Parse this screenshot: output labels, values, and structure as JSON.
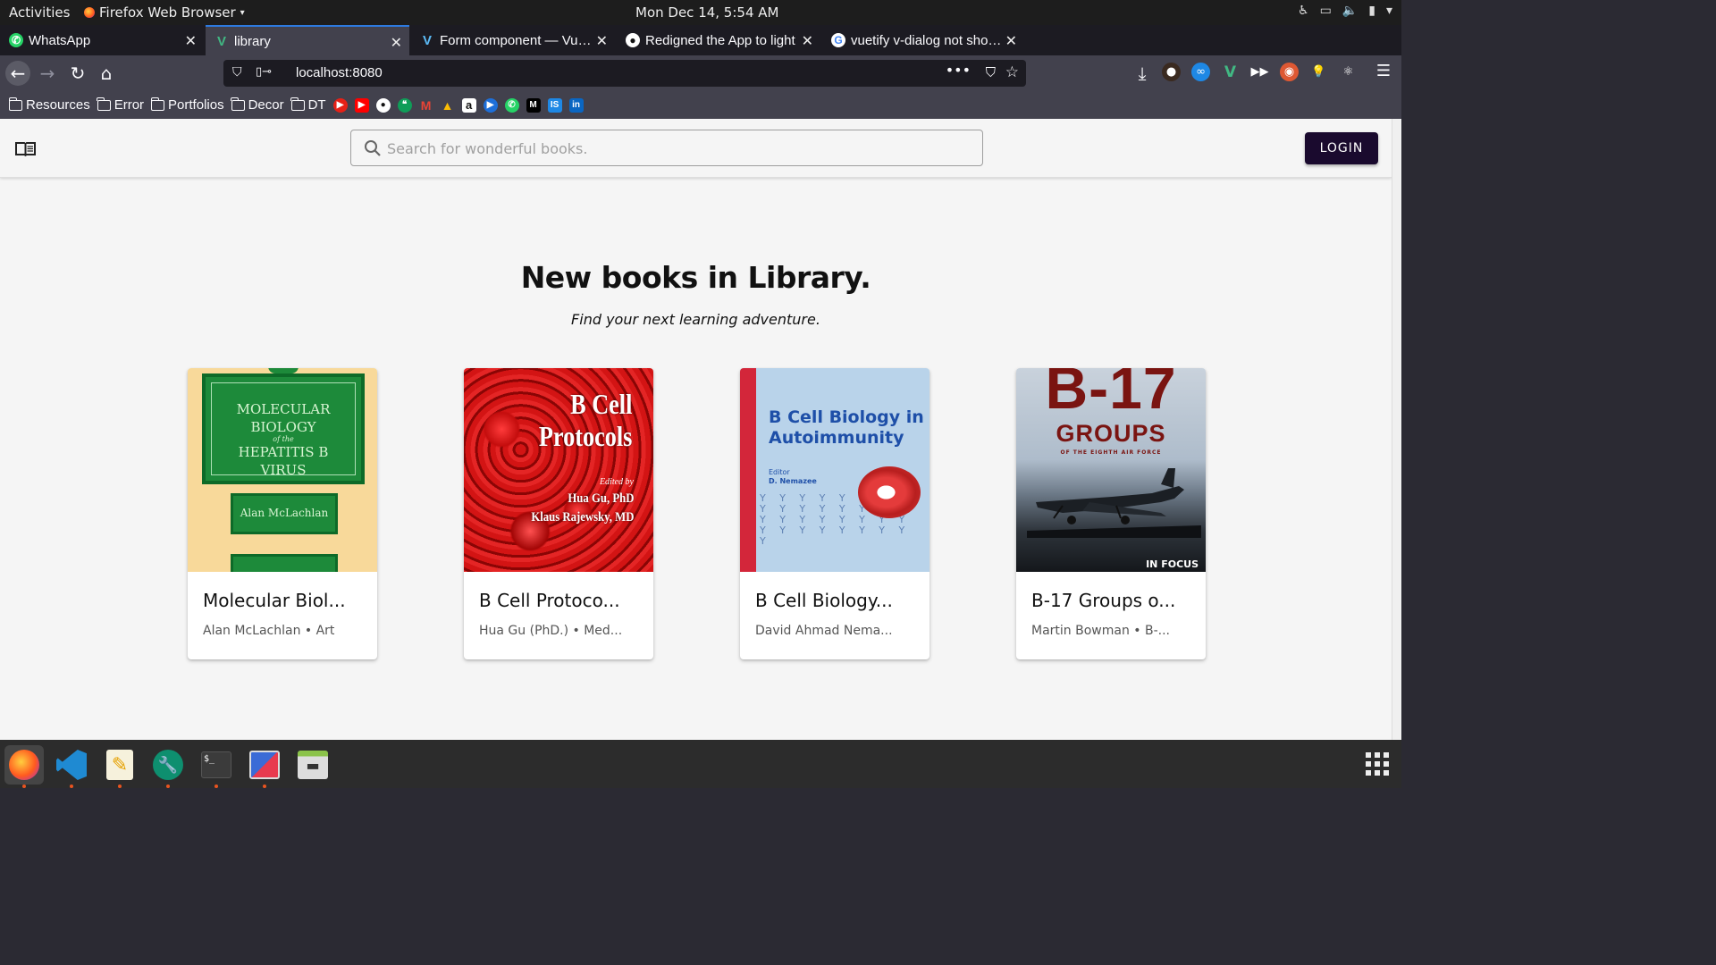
{
  "system": {
    "activities": "Activities",
    "app_name": "Firefox Web Browser",
    "clock": "Mon Dec 14,  5:54 AM"
  },
  "tabs": [
    {
      "title": "WhatsApp",
      "icon": "whatsapp-icon",
      "active": false
    },
    {
      "title": "library",
      "icon": "vue-icon",
      "active": true
    },
    {
      "title": "Form component — Vuetify",
      "icon": "vuetify-icon",
      "active": false
    },
    {
      "title": "Redigned the App to light",
      "icon": "github-icon",
      "active": false
    },
    {
      "title": "vuetify v-dialog not showing",
      "icon": "google-icon",
      "active": false
    }
  ],
  "address_bar": {
    "url": "localhost:8080"
  },
  "bookmarks": {
    "folders": [
      "Resources",
      "Error",
      "Portfolios",
      "Decor",
      "DT"
    ]
  },
  "app": {
    "search_placeholder": "Search for wonderful books.",
    "login_label": "LOGIN",
    "heading": "New books in Library.",
    "subheading": "Find your next learning adventure.",
    "books": [
      {
        "title": "Molecular Biol...",
        "meta": "Alan McLachlan • Art",
        "cover_lines": [
          "MOLECULAR",
          "BIOLOGY",
          "of the",
          "HEPATITIS B",
          "VIRUS"
        ],
        "cover_author": "Alan McLachlan"
      },
      {
        "title": "B Cell Protoco...",
        "meta": "Hua Gu (PhD.) • Med...",
        "cover_lines": [
          "B Cell",
          "Protocols"
        ],
        "cover_edited": "Edited by",
        "cover_authors": [
          "Hua Gu, PhD",
          "Klaus Rajewsky, MD"
        ]
      },
      {
        "title": "B Cell Biology...",
        "meta": "David Ahmad Nema...",
        "cover_lines": [
          "B Cell Biology in",
          "Autoimmunity"
        ],
        "cover_editor": [
          "Editor",
          "D. Nemazee"
        ]
      },
      {
        "title": "B-17 Groups o...",
        "meta": "Martin Bowman • B-...",
        "cover_big": "B-17",
        "cover_groups": "GROUPS",
        "cover_sub": "OF THE EIGHTH AIR FORCE",
        "cover_series": "IN FOCUS"
      }
    ]
  },
  "colors": {
    "login_bg": "#1a0a2e",
    "browser_chrome": "#42414d",
    "accent_tab": "#2d7ae0",
    "page_bg": "#f5f5f5"
  }
}
